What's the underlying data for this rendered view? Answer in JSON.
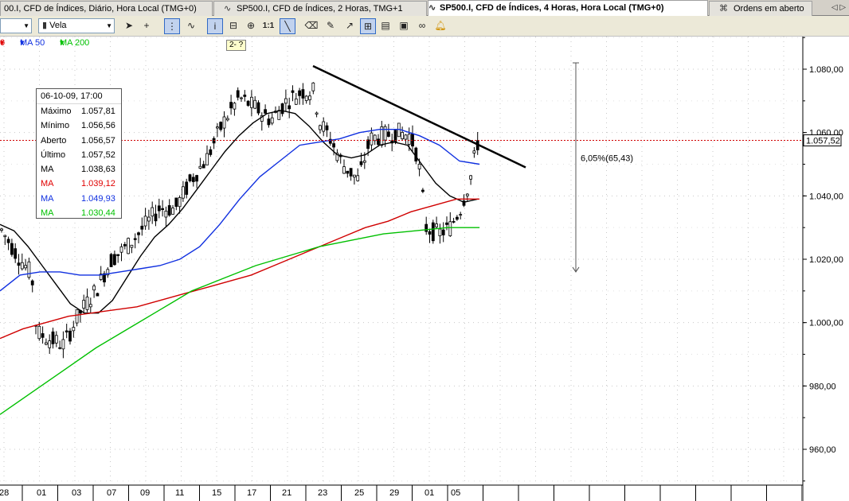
{
  "tabs": [
    {
      "label": "00.I, CFD de Índices, Diário, Hora Local (TMG+0)",
      "active": false
    },
    {
      "label": "SP500.I, CFD de Índices, 2 Horas, TMG+1",
      "active": false
    },
    {
      "label": "SP500.I, CFD de Índices, 4 Horas, Hora Local (TMG+0)",
      "active": true
    },
    {
      "label": "Ordens em aberto",
      "active": false
    }
  ],
  "tab_nav_label": "◁ ▷",
  "toolbar": {
    "chart_type_value": "Vela",
    "scale_label": "1:1",
    "icons": [
      "cursor-icon",
      "crosshair-icon",
      "grid-icon",
      "indicator-icon",
      "info-icon",
      "zoom-out-icon",
      "zoom-in-icon",
      "scale-icon",
      "line-tool-icon",
      "eraser-icon",
      "paint-icon",
      "arrow-tool-icon",
      "magnet-icon",
      "template-icon",
      "screenshot-icon",
      "link-icon",
      "alert-icon"
    ]
  },
  "indicators": [
    {
      "label": "0",
      "color": "#e00000"
    },
    {
      "label": "MA 50",
      "color": "#1030e0"
    },
    {
      "label": "MA 200",
      "color": "#00c000"
    }
  ],
  "zoom_tag": "2- ?",
  "data_window": {
    "title": "06-10-09, 17:00",
    "rows": [
      {
        "label": "Máximo",
        "value": "1.057,81",
        "color": "#000000"
      },
      {
        "label": "Mínimo",
        "value": "1.056,56",
        "color": "#000000"
      },
      {
        "label": "Aberto",
        "value": "1.056,57",
        "color": "#000000"
      },
      {
        "label": "Último",
        "value": "1.057,52",
        "color": "#000000"
      },
      {
        "label": "MA",
        "value": "1.038,63",
        "color": "#000000"
      },
      {
        "label": "MA",
        "value": "1.039,12",
        "color": "#e00000"
      },
      {
        "label": "MA",
        "value": "1.049,93",
        "color": "#1030e0"
      },
      {
        "label": "MA",
        "value": "1.030,44",
        "color": "#00c000"
      }
    ]
  },
  "chart_data": {
    "type": "line",
    "ylim": [
      950,
      1090
    ],
    "y_ticks": [
      960,
      980,
      1000,
      1020,
      1040,
      1060,
      1080
    ],
    "y_tick_labels": [
      "960,00",
      "980,00",
      "1.000,00",
      "1.020,00",
      "1.040,00",
      "1.060,00",
      "1.080,00"
    ],
    "x_ticks": [
      "28",
      "01",
      "03",
      "07",
      "09",
      "11",
      "15",
      "17",
      "21",
      "23",
      "25",
      "29",
      "01",
      "05"
    ],
    "current_price": 1057.52,
    "current_price_label": "1.057,52",
    "measure_label": "6,05%(65,43)",
    "measure_range": [
      1016,
      1082
    ],
    "trendline": [
      [
        0,
        1081
      ],
      [
        1,
        1049
      ]
    ],
    "series": [
      {
        "color": "#000000",
        "values": [
          1031,
          1029,
          1024,
          1018,
          1012,
          1006,
          1003,
          1003,
          1007,
          1014,
          1021,
          1027,
          1031,
          1036,
          1042,
          1048,
          1054,
          1059,
          1063,
          1066,
          1067,
          1066,
          1062,
          1057,
          1053,
          1052,
          1053,
          1056,
          1057,
          1056,
          1050,
          1044,
          1040,
          1038,
          1039
        ]
      },
      {
        "color": "#d00000",
        "values": [
          995,
          998,
          1000,
          1002,
          1003,
          1004,
          1005,
          1007,
          1009,
          1011,
          1013,
          1015,
          1018,
          1021,
          1024,
          1027,
          1030,
          1032,
          1035,
          1037,
          1039,
          1039
        ]
      },
      {
        "color": "#1030e0",
        "values": [
          1010,
          1015,
          1016,
          1016,
          1015,
          1015,
          1016,
          1017,
          1018,
          1020,
          1024,
          1031,
          1039,
          1046,
          1051,
          1056,
          1057,
          1058,
          1060,
          1061,
          1061,
          1059,
          1056,
          1051,
          1050
        ]
      },
      {
        "color": "#00c000",
        "values": [
          971,
          978,
          985,
          992,
          998,
          1004,
          1010,
          1014,
          1018,
          1021,
          1024,
          1026,
          1028,
          1029,
          1030,
          1030
        ]
      }
    ]
  }
}
